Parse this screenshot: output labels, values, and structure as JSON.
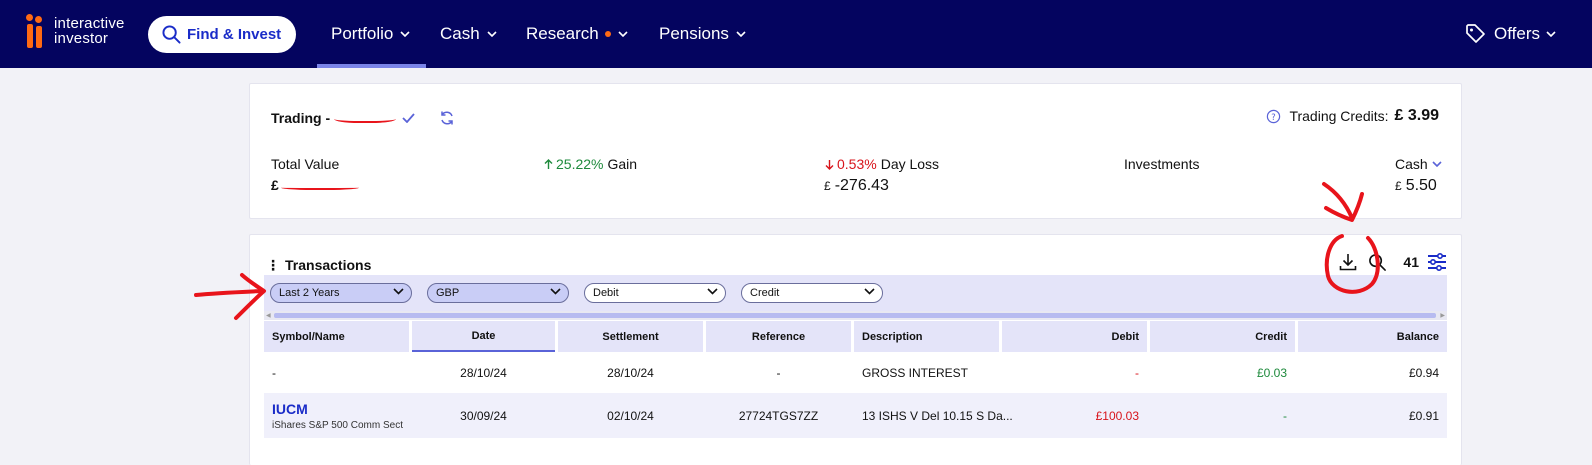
{
  "brand": {
    "name_line1": "interactive",
    "name_line2": "investor"
  },
  "nav": {
    "find_invest": "Find & Invest",
    "items": [
      {
        "label": "Portfolio"
      },
      {
        "label": "Cash"
      },
      {
        "label": "Research"
      },
      {
        "label": "Pensions"
      }
    ],
    "offers": "Offers"
  },
  "account": {
    "title": "Trading -",
    "credits_label": "Trading Credits:",
    "credits_value": "£ 3.99",
    "stats": {
      "total_value_label": "Total Value",
      "total_value_currency": "£",
      "gain_pct": "25.22%",
      "gain_label": "Gain",
      "day_loss_pct": "0.53%",
      "day_loss_label": "Day Loss",
      "day_loss_currency": "£",
      "day_loss_value": "-276.43",
      "investments_label": "Investments",
      "cash_label": "Cash",
      "cash_currency": "£",
      "cash_value": "5.50"
    }
  },
  "transactions": {
    "title": "Transactions",
    "count": "41",
    "filters": {
      "period": "Last 2 Years",
      "currency": "GBP",
      "debit": "Debit",
      "credit": "Credit"
    },
    "columns": {
      "symbol": "Symbol/Name",
      "date": "Date",
      "settlement": "Settlement",
      "reference": "Reference",
      "description": "Description",
      "debit": "Debit",
      "credit": "Credit",
      "balance": "Balance"
    },
    "rows": [
      {
        "symbol": "-",
        "date": "28/10/24",
        "settlement": "28/10/24",
        "reference": "-",
        "description": "GROSS INTEREST",
        "debit": "-",
        "credit": "£0.03",
        "balance": "£0.94"
      },
      {
        "symbol": "IUCM",
        "symbol_sub": "iShares S&P 500 Comm Sect",
        "date": "30/09/24",
        "settlement": "02/10/24",
        "reference": "27724TGS7ZZ",
        "description": "13 ISHS V Del 10.15 S Da...",
        "debit": "£100.03",
        "credit": "-",
        "balance": "£0.91"
      }
    ]
  },
  "colors": {
    "nav_bg": "#04045f",
    "accent": "#1a2cc8",
    "brand_orange": "#ff6a13",
    "gain": "#1e8a3c",
    "loss": "#d8141b"
  }
}
